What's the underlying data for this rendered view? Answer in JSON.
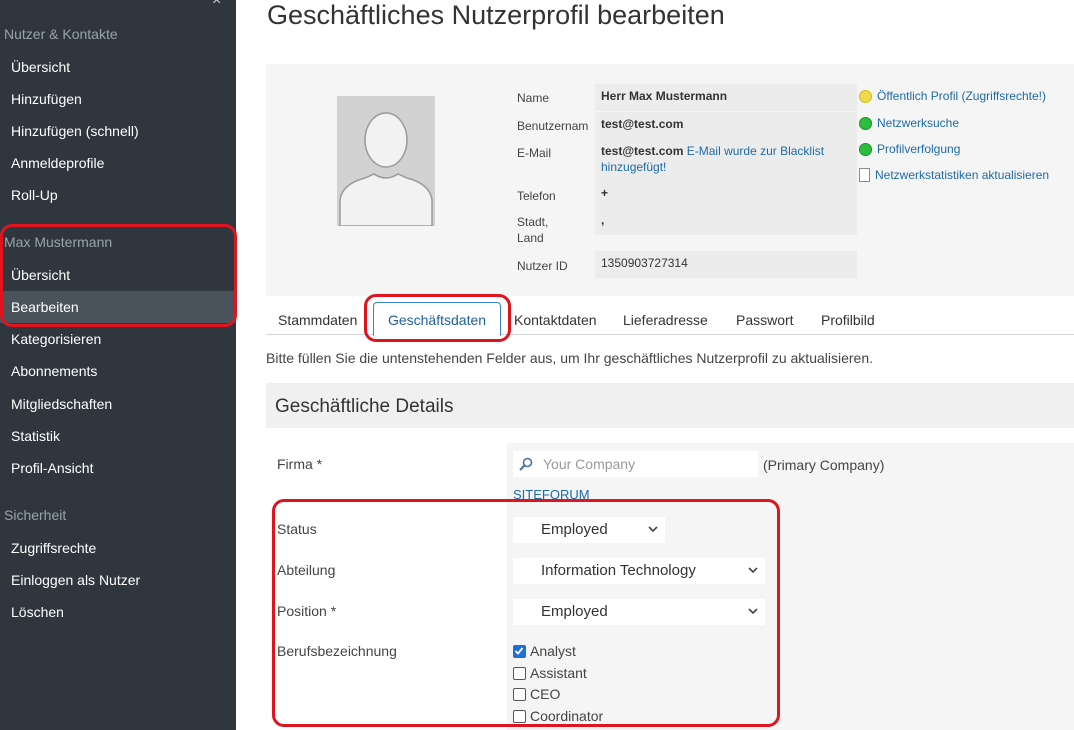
{
  "sidebar": {
    "close_glyph": "×",
    "section_users": "Nutzer & Kontakte",
    "users_items": [
      "Übersicht",
      "Hinzufügen",
      "Hinzufügen (schnell)",
      "Anmeldeprofile",
      "Roll-Up"
    ],
    "section_profile": "Max Mustermann",
    "profile_items": [
      "Übersicht",
      "Bearbeiten",
      "Kategorisieren",
      "Abonnements",
      "Mitgliedschaften",
      "Statistik",
      "Profil-Ansicht"
    ],
    "active_item": "Bearbeiten",
    "section_security": "Sicherheit",
    "security_items": [
      "Zugriffsrechte",
      "Einloggen als Nutzer",
      "Löschen"
    ]
  },
  "page": {
    "title": "Geschäftliches Nutzerprofil bearbeiten"
  },
  "profile": {
    "labels": {
      "name": "Name",
      "username": "Benutzernam",
      "email": "E-Mail",
      "phone": "Telefon",
      "city_line1": "Stadt,",
      "city_line2": "Land",
      "user_id": "Nutzer ID"
    },
    "values": {
      "name": "Herr Max Mustermann",
      "username": "test@test.com",
      "email": "test@test.com",
      "email_note_1": "E-Mail wurde zur Blacklist",
      "email_note_2": "hinzugefügt!",
      "phone": "+",
      "city": ",",
      "user_id": "1350903727314"
    },
    "side_links": [
      "Öffentlich Profil (Zugriffsrechte!)",
      "Netzwerksuche",
      "Profilverfolgung",
      "Netzwerkstatistiken aktualisieren"
    ]
  },
  "tabs": [
    "Stammdaten",
    "Geschäftsdaten",
    "Kontaktdaten",
    "Lieferadresse",
    "Passwort",
    "Profilbild"
  ],
  "active_tab": "Geschäftsdaten",
  "intro": "Bitte füllen Sie die untenstehenden Felder aus, um Ihr geschäftliches Nutzerprofil zu aktualisieren.",
  "section": {
    "title": "Geschäftliche Details"
  },
  "form": {
    "firma_label": "Firma *",
    "firma_placeholder": "Your Company",
    "firma_note": "(Primary Company)",
    "firma_link": "SITEFORUM",
    "status_label": "Status",
    "status_value": "Employed",
    "abteilung_label": "Abteilung",
    "abteilung_value": "Information Technology",
    "position_label": "Position *",
    "position_value": "Employed",
    "beruf_label": "Berufsbezeichnung",
    "beruf_options": [
      {
        "label": "Analyst",
        "checked": true
      },
      {
        "label": "Assistant",
        "checked": false
      },
      {
        "label": "CEO",
        "checked": false
      },
      {
        "label": "Coordinator",
        "checked": false
      }
    ]
  },
  "colors": {
    "sidebar_bg": "#2f363d",
    "highlight_red": "#e0141e",
    "link_blue": "#1e6aa8",
    "tab_blue": "#3b7fc4"
  }
}
